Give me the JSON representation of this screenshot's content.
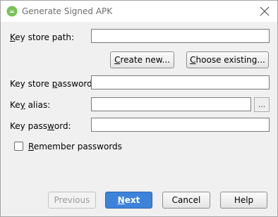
{
  "window": {
    "title": "Generate Signed APK"
  },
  "form": {
    "key_store_path_label": {
      "pre": "",
      "mn": "K",
      "post": "ey store path:"
    },
    "key_store_path_value": "",
    "create_new_label": {
      "pre": "",
      "mn": "C",
      "post": "reate new..."
    },
    "choose_existing_label": {
      "pre": "",
      "mn": "C",
      "post": "hoose existing..."
    },
    "key_store_password_label": {
      "pre": "Key store ",
      "mn": "p",
      "post": "assword:"
    },
    "key_store_password_value": "",
    "key_alias_label": {
      "pre": "Ke",
      "mn": "y",
      "post": " alias:"
    },
    "key_alias_value": "",
    "key_alias_browse": "...",
    "key_password_label": {
      "pre": "Key pass",
      "mn": "w",
      "post": "ord:"
    },
    "key_password_value": "",
    "remember_label": {
      "pre": "",
      "mn": "R",
      "post": "emember passwords"
    },
    "remember_checked": false
  },
  "footer": {
    "previous": "Previous",
    "next": {
      "pre": "",
      "mn": "N",
      "post": "ext"
    },
    "cancel": "Cancel",
    "help": "Help"
  },
  "colors": {
    "primary_button": "#3d83d9",
    "dialog_background": "#f0f0f0",
    "android_green": "#78c257"
  }
}
